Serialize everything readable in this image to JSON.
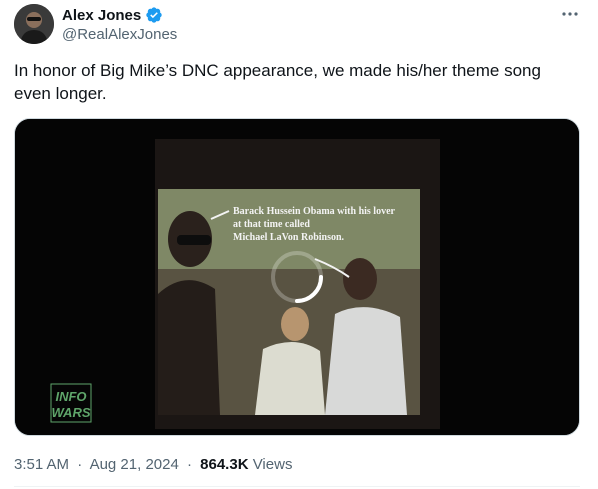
{
  "author": {
    "display_name": "Alex Jones",
    "handle": "@RealAlexJones",
    "verified": true
  },
  "tweet": {
    "text": "In honor of Big Mike’s DNC appearance, we made his/her theme song even longer."
  },
  "media": {
    "type": "video",
    "state": "loading",
    "caption_lines": [
      "Barack Hussein Obama with his lover",
      "at that time called",
      "Michael LaVon Robinson."
    ],
    "watermark_lines": [
      "INFO",
      "WARS"
    ]
  },
  "meta": {
    "time": "3:51 AM",
    "date": "Aug 21, 2024",
    "views_count": "864.3K",
    "views_label": "Views",
    "separator": "·"
  },
  "icons": {
    "more": "more-horizontal-icon",
    "verified": "verified-badge-icon",
    "spinner": "loading-spinner-icon"
  },
  "colors": {
    "verified_blue": "#1d9bf0",
    "secondary_text": "#536471",
    "primary_text": "#0f1419"
  }
}
